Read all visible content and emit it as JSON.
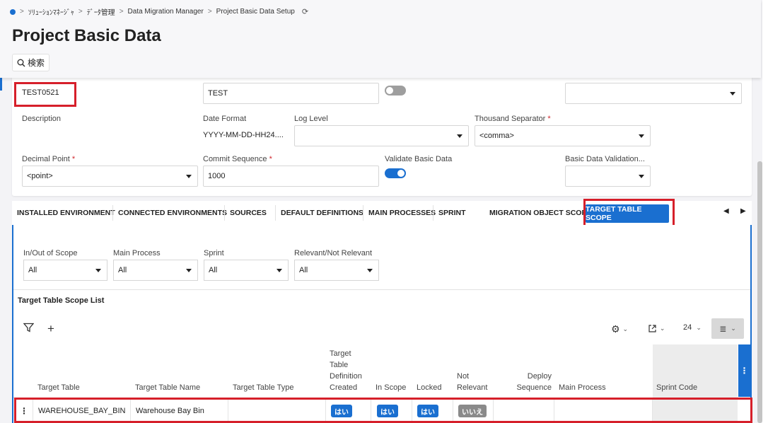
{
  "breadcrumb": {
    "items": [
      "ｿﾘｭｰｼｮﾝﾏﾈｰｼﾞｬ",
      "ﾃﾞｰﾀ管理",
      "Data Migration Manager",
      "Project Basic Data Setup"
    ]
  },
  "page": {
    "title": "Project Basic Data"
  },
  "search": {
    "label": "検索"
  },
  "form": {
    "row1": {
      "project_id_value": "TEST0521",
      "description_value": "TEST",
      "template_project": false,
      "based_on_template_value": ""
    },
    "description_label": "Description",
    "date_format_label": "Date Format",
    "date_format_value": "YYYY-MM-DD-HH24....",
    "log_level_label": "Log Level",
    "log_level_value": "",
    "thousand_sep_label": "Thousand Separator",
    "thousand_sep_value": "<comma>",
    "decimal_point_label": "Decimal Point",
    "decimal_point_value": "<point>",
    "commit_seq_label": "Commit Sequence",
    "commit_seq_value": "1000",
    "validate_label": "Validate Basic Data",
    "validate_value": true,
    "basic_validation_label": "Basic Data Validation...",
    "basic_validation_value": "",
    "required_mark": "*"
  },
  "tabs": [
    "INSTALLED ENVIRONMENT",
    "CONNECTED ENVIRONMENTS",
    "SOURCES",
    "DEFAULT DEFINITIONS",
    "MAIN PROCESSES",
    "SPRINT",
    "MIGRATION OBJECT SCOPE",
    "TARGET TABLE SCOPE"
  ],
  "filters": {
    "scope_label": "In/Out of Scope",
    "scope_value": "All",
    "main_process_label": "Main Process",
    "main_process_value": "All",
    "sprint_label": "Sprint",
    "sprint_value": "All",
    "relevant_label": "Relevant/Not Relevant",
    "relevant_value": "All"
  },
  "list": {
    "title": "Target Table Scope List",
    "page_size": "24",
    "columns": {
      "target_table": "Target Table",
      "target_table_name": "Target Table Name",
      "target_table_type": "Target Table Type",
      "def_created_1": "Target",
      "def_created_2": "Table",
      "def_created_3": "Definition",
      "def_created_4": "Created",
      "in_scope": "In Scope",
      "locked": "Locked",
      "not_relevant_1": "Not",
      "not_relevant_2": "Relevant",
      "deploy_1": "Deploy",
      "deploy_2": "Sequence",
      "main_process": "Main Process",
      "sprint_code": "Sprint Code"
    },
    "rows": [
      {
        "target_table": "WAREHOUSE_BAY_BIN",
        "target_table_name": "Warehouse Bay Bin",
        "target_table_type": "",
        "def_created": "はい",
        "in_scope": "はい",
        "locked": "はい",
        "not_relevant": "いいえ",
        "deploy_sequence": "",
        "main_process": "",
        "sprint_code": ""
      }
    ]
  }
}
